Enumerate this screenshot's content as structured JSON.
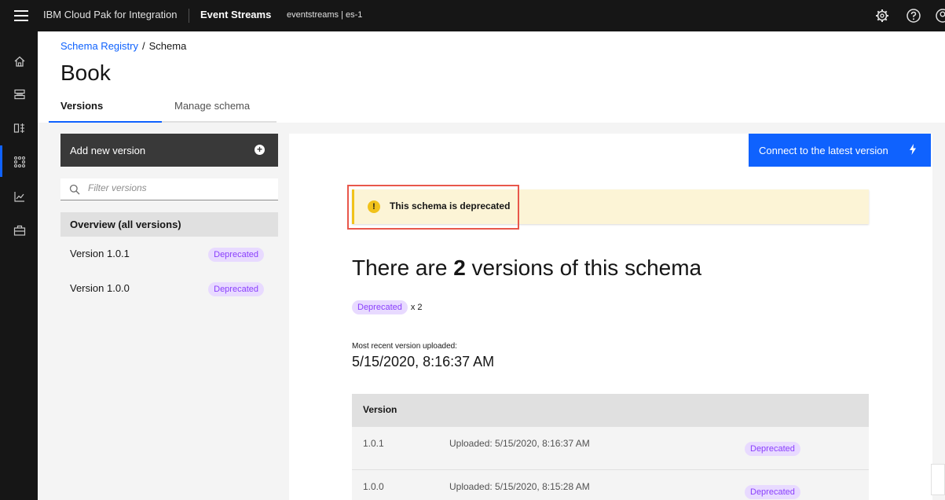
{
  "topbar": {
    "product": "IBM Cloud Pak for Integration",
    "app": "Event Streams",
    "instance": "eventstreams | es-1"
  },
  "breadcrumb": {
    "parent": "Schema Registry",
    "separator": "/",
    "current": "Schema"
  },
  "page": {
    "title": "Book"
  },
  "tabs": [
    {
      "label": "Versions"
    },
    {
      "label": "Manage schema"
    }
  ],
  "sidebar": {
    "add_label": "Add new version",
    "filter_placeholder": "Filter versions",
    "items": [
      {
        "label": "Overview (all versions)",
        "tag": ""
      },
      {
        "label": "Version 1.0.1",
        "tag": "Deprecated"
      },
      {
        "label": "Version 1.0.0",
        "tag": "Deprecated"
      }
    ]
  },
  "main": {
    "connect_label": "Connect to the latest version",
    "notice": "This schema is deprecated",
    "heading_prefix": "There are",
    "heading_count": "2",
    "heading_suffix": "versions of this schema",
    "dep_tag": "Deprecated",
    "dep_multiplier": "x 2",
    "recent_label": "Most recent version uploaded:",
    "recent_value": "5/15/2020, 8:16:37 AM",
    "table": {
      "header": "Version",
      "rows": [
        {
          "version": "1.0.1",
          "uploaded": "Uploaded: 5/15/2020, 8:16:37 AM",
          "status": "Deprecated"
        },
        {
          "version": "1.0.0",
          "uploaded": "Uploaded: 5/15/2020, 8:15:28 AM",
          "status": "Deprecated"
        }
      ]
    }
  },
  "colors": {
    "primary": "#0f62fe",
    "dark": "#161616",
    "warning": "#f1c21b",
    "deprecated_tag_bg": "#e8daff",
    "deprecated_tag_text": "#8a3ffc",
    "highlight_border": "#e8574b"
  }
}
